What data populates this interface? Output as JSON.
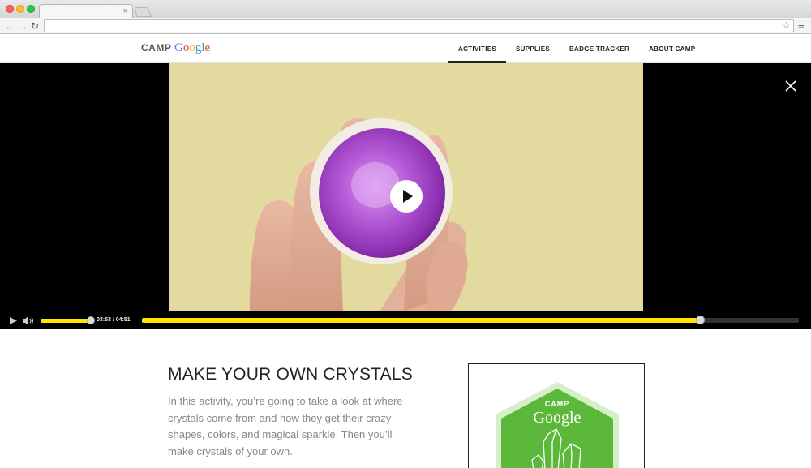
{
  "browser": {
    "tab_close_glyph": "×",
    "star_glyph": "☆",
    "menu_glyph": "≡"
  },
  "site": {
    "logo_camp": "CAMP",
    "logo_google_letters": [
      "G",
      "o",
      "o",
      "g",
      "l",
      "e"
    ],
    "nav": [
      {
        "label": "ACTIVITIES",
        "active": true
      },
      {
        "label": "SUPPLIES",
        "active": false
      },
      {
        "label": "BADGE TRACKER",
        "active": false
      },
      {
        "label": "ABOUT CAMP",
        "active": false
      }
    ]
  },
  "video": {
    "time_current": "03:53",
    "time_total": "04:51",
    "time_display": "03:53 / 04:51",
    "progress": 0.85,
    "volume": 1.0,
    "colors": {
      "accent": "#ffe500",
      "backdrop": "#e3da9f",
      "geode_purple": "#b04ad0"
    }
  },
  "activity": {
    "title": "MAKE YOUR OWN CRYSTALS",
    "description": "In this activity, you’re going to take a look at where crystals come from and how they get their crazy shapes, colors, and magical sparkle. Then you’ll make crystals of your own."
  },
  "badge": {
    "camp": "CAMP",
    "google": "Google",
    "color": "#5cb83a"
  }
}
